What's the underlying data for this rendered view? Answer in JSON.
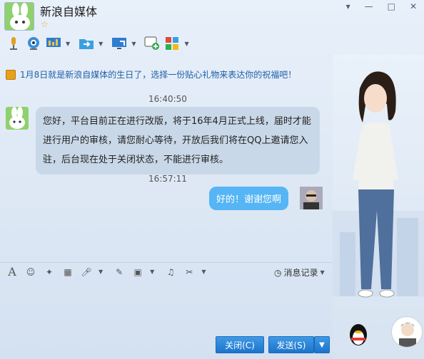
{
  "window": {
    "contact_name": "新浪自媒体"
  },
  "notice": {
    "text": "1月8日就是新浪自媒体的生日了，选择一份贴心礼物来表达你的祝福吧！"
  },
  "messages": [
    {
      "time": "16:40:50",
      "text_lines": [
        "您好，平台目前正在进行改版，将于16年4月正式上线，届时才能",
        "进行用户的审核，请您耐心等待，开放后我们将在QQ上邀请您入",
        "驻，后台现在处于关闭状态，不能进行审核。"
      ]
    },
    {
      "time": "16:57:11",
      "text": "好的！谢谢您啊"
    }
  ],
  "input_toolbar": {
    "history_label": "消息记录"
  },
  "buttons": {
    "close": "关闭(C)",
    "send": "发送(S)"
  },
  "colors": {
    "out_bubble": "#55b5f5",
    "in_bubble": "#c9d8e8",
    "button": "#1c74c9"
  }
}
